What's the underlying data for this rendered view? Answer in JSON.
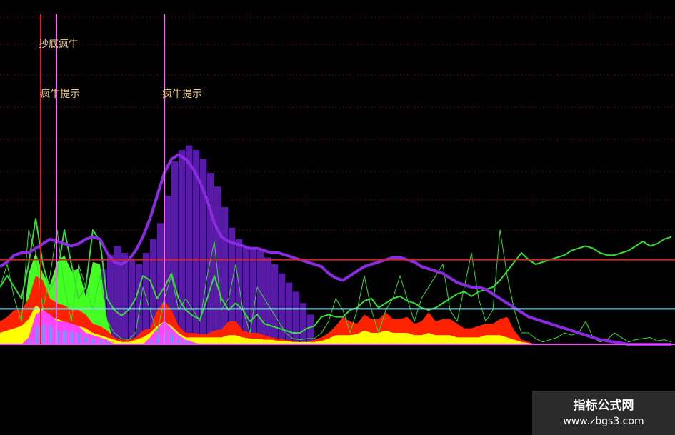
{
  "header": {
    "items": [
      {
        "text": "",
        "color": "#cccccc"
      },
      {
        "text": "",
        "color": "#bb44ff"
      },
      {
        "text": "",
        "color": "#ff4444"
      },
      {
        "text": "",
        "color": "#44ff44"
      },
      {
        "text": "",
        "color": "#ffffff"
      }
    ]
  },
  "annotations": {
    "signal_a": "抄底疯牛",
    "signal_b1": "疯牛提示",
    "signal_b2": "疯牛提示"
  },
  "watermark": {
    "title": "指标公式网",
    "url": "www.zbgs3.com"
  },
  "colors": {
    "background": "#000000",
    "red_level": "#dd2222",
    "cyan_level": "#88e8f0",
    "magenta_base": "#ff44ff",
    "purple_histogram": "#5a1aa8",
    "purple_line": "#8a2be2",
    "green_line": "#33dd33",
    "red_fill": "#ff2200",
    "yellow_fill": "#ffff00",
    "lime_fill": "#44ff22",
    "magenta_fill": "#ff44ff",
    "cyan_bar": "#55aaff"
  },
  "chart_data": {
    "type": "area",
    "x": [
      0,
      10,
      20,
      30,
      40,
      50,
      60,
      70,
      80,
      90,
      100,
      110,
      120,
      130,
      140,
      150,
      160,
      170,
      180,
      190,
      200,
      210,
      220,
      230,
      240,
      250,
      260,
      270,
      280,
      290,
      300,
      310,
      320,
      330,
      340,
      350,
      360,
      370,
      380,
      390,
      400,
      410,
      420,
      430,
      440,
      450,
      460,
      470,
      480,
      490,
      500,
      510,
      520,
      530,
      540,
      550,
      560,
      570,
      580,
      590,
      600,
      610,
      620,
      630,
      640,
      650,
      660,
      670,
      680,
      690,
      700,
      710,
      720,
      730,
      740,
      750,
      760,
      770,
      780,
      790,
      800,
      810,
      820,
      830,
      840,
      850,
      860,
      870,
      880,
      890,
      900,
      910,
      920,
      930,
      940
    ],
    "reference_levels": {
      "red": 0.74,
      "cyan": 0.31,
      "baseline": 0.0
    },
    "series": [
      {
        "kind": "purple_histogram",
        "values": [
          0,
          0,
          0,
          0,
          0,
          0,
          0,
          0,
          0,
          0.3,
          0.36,
          0.4,
          0.44,
          0.56,
          0.66,
          0.78,
          0.86,
          0.8,
          0.74,
          0.7,
          0.8,
          0.92,
          1.06,
          1.3,
          1.6,
          1.7,
          1.74,
          1.7,
          1.62,
          1.5,
          1.38,
          1.2,
          1.02,
          0.92,
          0.86,
          0.84,
          0.82,
          0.76,
          0.7,
          0.62,
          0.54,
          0.46,
          0.36,
          0.26,
          0,
          0,
          0,
          0,
          0,
          0,
          0,
          0,
          0,
          0,
          0,
          0,
          0,
          0,
          0,
          0,
          0,
          0,
          0,
          0,
          0,
          0,
          0,
          0,
          0,
          0,
          0,
          0,
          0,
          0,
          0,
          0,
          0,
          0,
          0,
          0,
          0,
          0,
          0,
          0,
          0,
          0,
          0,
          0,
          0,
          0,
          0,
          0,
          0,
          0,
          0
        ]
      },
      {
        "kind": "red_fill",
        "values": [
          0.2,
          0.24,
          0.3,
          0.3,
          0.4,
          0.6,
          0.56,
          0.4,
          0.36,
          0.34,
          0.3,
          0.3,
          0.26,
          0.18,
          0.16,
          0.12,
          0.06,
          0.04,
          0.04,
          0.06,
          0.12,
          0.14,
          0.3,
          0.38,
          0.3,
          0.16,
          0.1,
          0.1,
          0.09,
          0.09,
          0.12,
          0.13,
          0.2,
          0.2,
          0.12,
          0.1,
          0.1,
          0.08,
          0.06,
          0.05,
          0.04,
          0.03,
          0.02,
          0.02,
          0.04,
          0.06,
          0.1,
          0.16,
          0.24,
          0.2,
          0.18,
          0.26,
          0.22,
          0.22,
          0.28,
          0.22,
          0.22,
          0.24,
          0.18,
          0.2,
          0.28,
          0.2,
          0.22,
          0.22,
          0.18,
          0.14,
          0.14,
          0.16,
          0.18,
          0.18,
          0.22,
          0.24,
          0.12,
          0.04,
          0.02,
          0,
          0,
          0,
          0,
          0,
          0,
          0,
          0,
          0,
          0,
          0,
          0,
          0,
          0,
          0,
          0,
          0,
          0,
          0,
          0
        ]
      },
      {
        "kind": "yellow_fill",
        "values": [
          0.1,
          0.12,
          0.14,
          0.16,
          0.22,
          0.34,
          0.3,
          0.24,
          0.22,
          0.2,
          0.18,
          0.16,
          0.14,
          0.1,
          0.08,
          0.06,
          0.04,
          0.02,
          0.02,
          0.04,
          0.06,
          0.1,
          0.16,
          0.2,
          0.16,
          0.1,
          0.06,
          0.06,
          0.06,
          0.06,
          0.06,
          0.06,
          0.08,
          0.08,
          0.06,
          0.05,
          0.05,
          0.04,
          0.04,
          0.03,
          0.03,
          0.02,
          0.02,
          0.02,
          0.02,
          0.03,
          0.05,
          0.08,
          0.08,
          0.08,
          0.09,
          0.12,
          0.1,
          0.1,
          0.12,
          0.1,
          0.1,
          0.1,
          0.08,
          0.08,
          0.1,
          0.08,
          0.08,
          0.08,
          0.06,
          0.06,
          0.06,
          0.06,
          0.08,
          0.08,
          0.08,
          0.06,
          0.04,
          0.02,
          0.01,
          0,
          0,
          0,
          0,
          0,
          0,
          0,
          0,
          0,
          0,
          0,
          0,
          0,
          0,
          0,
          0,
          0,
          0,
          0,
          0
        ]
      },
      {
        "kind": "lime_fill",
        "values": [
          0,
          0,
          0,
          0,
          0.62,
          0.8,
          0.62,
          0.52,
          0.72,
          0.78,
          0.64,
          0.66,
          0.42,
          0.72,
          0.7,
          0.22,
          0,
          0,
          0,
          0,
          0,
          0,
          0.3,
          0.36,
          0.26,
          0,
          0,
          0,
          0,
          0,
          0,
          0,
          0,
          0,
          0,
          0,
          0,
          0,
          0,
          0,
          0,
          0,
          0,
          0,
          0,
          0,
          0,
          0,
          0,
          0,
          0,
          0,
          0,
          0,
          0,
          0,
          0,
          0,
          0,
          0,
          0,
          0,
          0,
          0,
          0,
          0,
          0,
          0,
          0,
          0,
          0,
          0,
          0,
          0,
          0,
          0,
          0,
          0,
          0,
          0,
          0,
          0,
          0,
          0,
          0,
          0,
          0,
          0,
          0,
          0,
          0,
          0,
          0,
          0,
          0
        ]
      },
      {
        "kind": "magenta_fill",
        "values": [
          0,
          0,
          0,
          0,
          0.06,
          0.26,
          0.3,
          0.26,
          0.2,
          0.2,
          0.18,
          0.16,
          0.1,
          0.08,
          0.06,
          0.04,
          0,
          0,
          0,
          0,
          0,
          0.06,
          0.14,
          0.2,
          0.14,
          0.08,
          0.04,
          0.02,
          0,
          0,
          0,
          0,
          0,
          0,
          0,
          0,
          0,
          0,
          0,
          0,
          0,
          0,
          0,
          0,
          0,
          0,
          0,
          0,
          0,
          0,
          0,
          0,
          0,
          0,
          0,
          0,
          0,
          0,
          0,
          0,
          0,
          0,
          0,
          0,
          0,
          0,
          0,
          0,
          0,
          0,
          0,
          0,
          0,
          0,
          0,
          0,
          0,
          0,
          0,
          0,
          0,
          0,
          0,
          0,
          0,
          0,
          0,
          0,
          0,
          0,
          0,
          0,
          0,
          0,
          0
        ]
      },
      {
        "kind": "purple_line",
        "values": [
          0.68,
          0.72,
          0.78,
          0.8,
          0.8,
          0.84,
          0.88,
          0.92,
          0.9,
          0.88,
          0.86,
          0.88,
          0.92,
          0.94,
          0.92,
          0.8,
          0.72,
          0.7,
          0.74,
          0.82,
          0.94,
          1.1,
          1.3,
          1.5,
          1.62,
          1.66,
          1.62,
          1.54,
          1.42,
          1.26,
          1.06,
          0.94,
          0.9,
          0.88,
          0.86,
          0.84,
          0.84,
          0.82,
          0.8,
          0.8,
          0.78,
          0.76,
          0.74,
          0.72,
          0.7,
          0.68,
          0.62,
          0.58,
          0.56,
          0.6,
          0.64,
          0.68,
          0.7,
          0.72,
          0.74,
          0.76,
          0.76,
          0.74,
          0.72,
          0.68,
          0.66,
          0.64,
          0.62,
          0.58,
          0.54,
          0.52,
          0.5,
          0.5,
          0.48,
          0.44,
          0.4,
          0.36,
          0.32,
          0.28,
          0.24,
          0.22,
          0.2,
          0.18,
          0.16,
          0.14,
          0.12,
          0.1,
          0.08,
          0.06,
          0.04,
          0.03,
          0.02,
          0.01,
          0,
          0,
          0,
          0,
          0,
          0,
          0
        ]
      },
      {
        "kind": "green_line",
        "values": [
          0.5,
          0.6,
          0.5,
          0.4,
          0.7,
          1.1,
          0.7,
          0.48,
          0.6,
          1.0,
          0.7,
          0.4,
          0.5,
          1.0,
          0.9,
          0.4,
          0.3,
          0.25,
          0.3,
          0.4,
          0.6,
          0.56,
          0.4,
          0.5,
          0.62,
          0.4,
          0.3,
          0.25,
          0.22,
          0.4,
          0.6,
          0.4,
          0.3,
          0.36,
          0.3,
          0.2,
          0.26,
          0.18,
          0.16,
          0.14,
          0.12,
          0.1,
          0.1,
          0.14,
          0.16,
          0.24,
          0.26,
          0.24,
          0.24,
          0.3,
          0.32,
          0.38,
          0.4,
          0.32,
          0.36,
          0.4,
          0.42,
          0.38,
          0.36,
          0.32,
          0.3,
          0.32,
          0.36,
          0.4,
          0.44,
          0.46,
          0.42,
          0.46,
          0.48,
          0.5,
          0.56,
          0.64,
          0.72,
          0.8,
          0.74,
          0.7,
          0.72,
          0.74,
          0.76,
          0.78,
          0.82,
          0.84,
          0.86,
          0.84,
          0.8,
          0.78,
          0.78,
          0.8,
          0.82,
          0.86,
          0.9,
          0.86,
          0.88,
          0.92,
          0.94
        ]
      },
      {
        "kind": "thin_green_spikes",
        "values": [
          0.5,
          0.7,
          0.4,
          0.2,
          1.0,
          0.8,
          0.3,
          0.6,
          1.0,
          0.5,
          0.2,
          0.7,
          0.5,
          0.3,
          0.6,
          0.2,
          0.1,
          0.05,
          0.04,
          0.1,
          0.5,
          0.3,
          0.1,
          0.4,
          0.6,
          0.3,
          0.4,
          0.3,
          0.2,
          0.6,
          0.9,
          0.3,
          0.4,
          0.7,
          0.3,
          0.1,
          0.5,
          0.4,
          0.3,
          0.2,
          0.1,
          0.05,
          0.04,
          0.05,
          0.05,
          0.1,
          0.2,
          0.4,
          0.3,
          0.1,
          0.3,
          0.6,
          0.3,
          0.1,
          0.3,
          0.4,
          0.6,
          0.4,
          0.2,
          0.4,
          0.5,
          0.6,
          0.7,
          0.3,
          0.2,
          0.5,
          0.8,
          0.4,
          0.2,
          0.3,
          1.0,
          0.6,
          0.3,
          0.1,
          0.1,
          0.05,
          0.02,
          0.04,
          0.06,
          0.1,
          0.08,
          0.1,
          0.2,
          0.06,
          0.02,
          0.04,
          0.1,
          0.06,
          0.02,
          0.04,
          0.05,
          0.06,
          0.03,
          0.04,
          0.02
        ]
      }
    ],
    "signals": [
      {
        "label_key": "signal_a",
        "x": 57,
        "color": "#dd2222"
      },
      {
        "label_key": "signal_a",
        "x": 79,
        "color": "#ff66ff"
      },
      {
        "label_key": "signal_b2",
        "x": 230,
        "color": "#ff66ff"
      }
    ]
  }
}
